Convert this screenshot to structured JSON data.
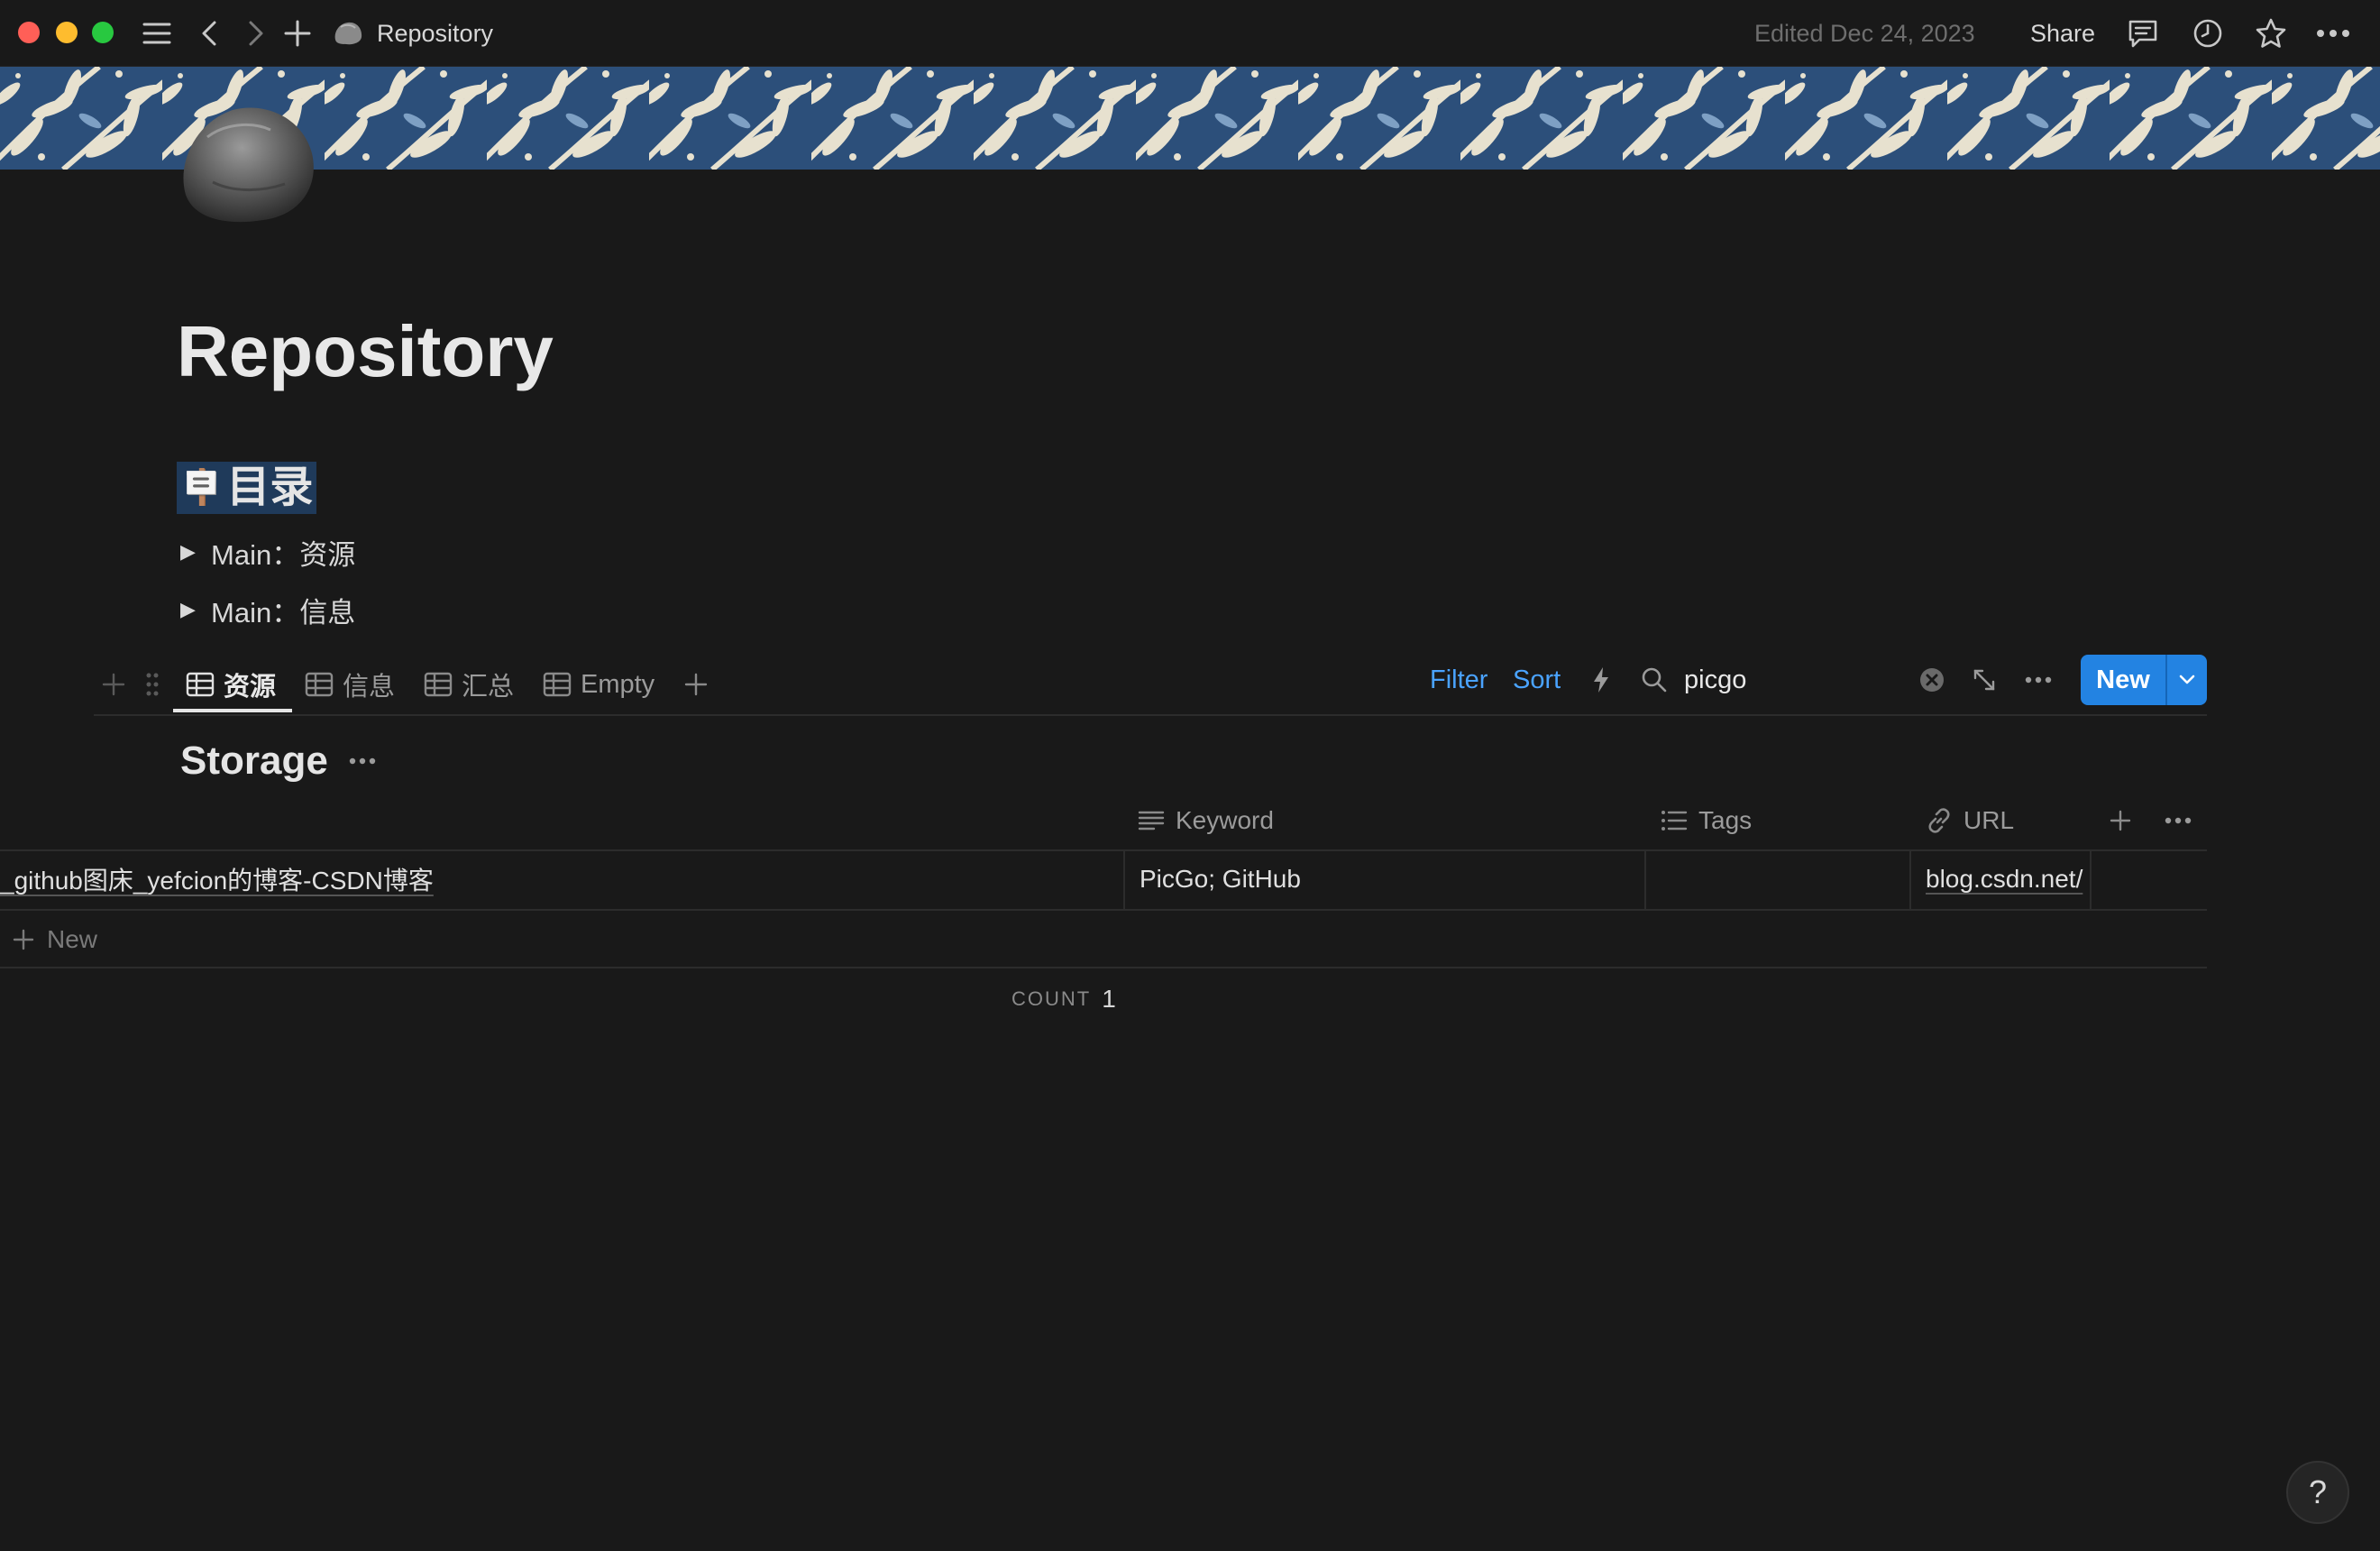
{
  "titlebar": {
    "breadcrumb": "Repository",
    "edited": "Edited Dec 24, 2023",
    "share_label": "Share"
  },
  "page": {
    "title": "Repository",
    "toc_emoji": "🪧",
    "toc_heading": "目录",
    "toggles": [
      "Main：资源",
      "Main：信息"
    ]
  },
  "views": {
    "tabs": [
      "资源",
      "信息",
      "汇总",
      "Empty"
    ],
    "active": 0,
    "filter_label": "Filter",
    "sort_label": "Sort",
    "search_value": "picgo",
    "new_label": "New"
  },
  "database": {
    "title": "Storage",
    "columns": [
      {
        "name": "Keyword",
        "icon": "text-lines-icon"
      },
      {
        "name": "Tags",
        "icon": "list-icon"
      },
      {
        "name": "URL",
        "icon": "link-icon"
      }
    ],
    "rows": [
      {
        "name": "_github图床_yefcion的博客-CSDN博客",
        "keyword": "PicGo; GitHub",
        "tags": "",
        "url": "blog.csdn.net/"
      }
    ],
    "new_row_label": "New",
    "count_label": "COUNT",
    "count_value": "1"
  },
  "help_label": "?",
  "colors": {
    "background": "#191919",
    "accent": "#2383e2",
    "link": "#4aa3ff",
    "highlight": "#1f3a5a"
  }
}
